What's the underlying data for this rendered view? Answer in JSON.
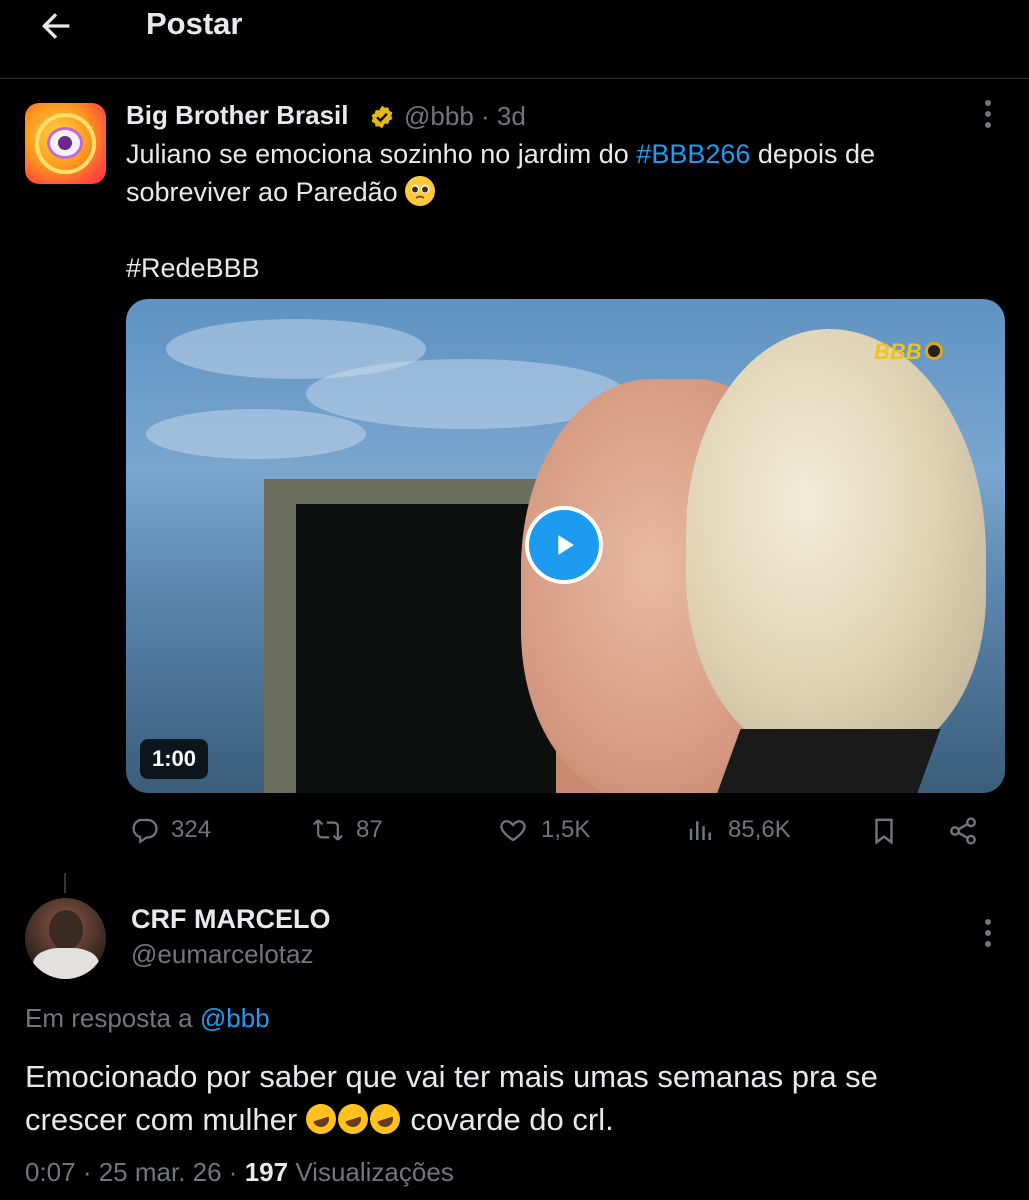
{
  "header": {
    "title": "Postar"
  },
  "tweet": {
    "author_name": "Big Brother Brasil",
    "handle": "@bbb",
    "separator": "·",
    "time": "3d",
    "text_line1_a": "Juliano se emociona sozinho no jardim do ",
    "hashtag1": "#BBB266",
    "text_line1_b": " depois de",
    "text_line2": "sobreviver ao Paredão ",
    "emoji": "pleading-face-emoji",
    "hashtag2": "#RedeBBB",
    "video": {
      "logo": "BBB",
      "duration": "1:00"
    },
    "actions": {
      "replies": "324",
      "retweets": "87",
      "likes": "1,5K",
      "views": "85,6K"
    }
  },
  "reply": {
    "author_name": "CRF MARCELO",
    "handle": "@eumarcelotaz",
    "reply_to_label": "Em resposta a ",
    "reply_to_handle": "@bbb",
    "text_line1": "Emocionado por saber que vai ter mais umas semanas pra se",
    "text_line2_a": "crescer com mulher ",
    "emoji": "rolling-on-floor-laughing-emoji",
    "emoji_count": 3,
    "text_line2_b": " covarde do crl.",
    "time": "0:07",
    "date": "25 mar. 26",
    "views_count": "197",
    "views_label": "Visualizações"
  },
  "colors": {
    "accent": "#1d9bf0",
    "muted": "#71767b",
    "text": "#e7e9ea",
    "background": "#000000",
    "verified": "#e2b719"
  }
}
